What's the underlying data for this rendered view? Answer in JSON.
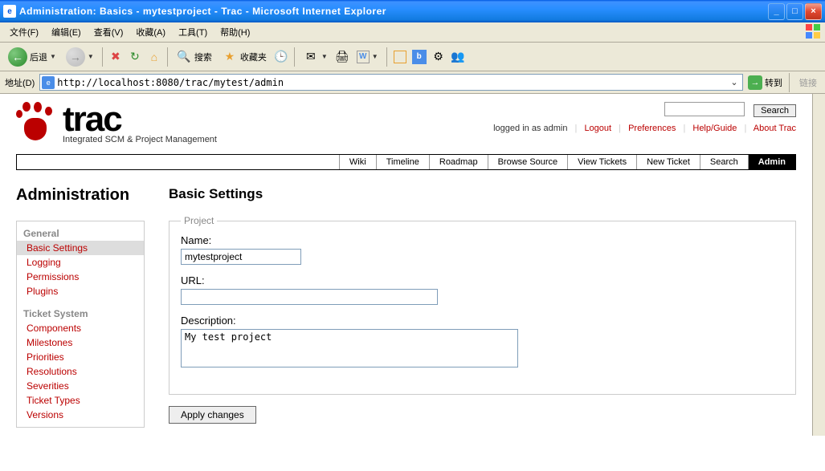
{
  "window": {
    "title": "Administration: Basics - mytestproject - Trac - Microsoft Internet Explorer"
  },
  "menubar": {
    "file": "文件(F)",
    "edit": "编辑(E)",
    "view": "查看(V)",
    "favorites": "收藏(A)",
    "tools": "工具(T)",
    "help": "帮助(H)"
  },
  "toolbar": {
    "back": "后退",
    "search": "搜索",
    "favorites": "收藏夹"
  },
  "addressbar": {
    "label": "地址(D)",
    "url": "http://localhost:8080/trac/mytest/admin",
    "go": "转到",
    "links": "链接"
  },
  "trac": {
    "subtitle": "Integrated SCM & Project Management",
    "search_btn": "Search",
    "logged_in": "logged in as admin",
    "logout": "Logout",
    "prefs": "Preferences",
    "help": "Help/Guide",
    "about": "About Trac"
  },
  "mainnav": {
    "wiki": "Wiki",
    "timeline": "Timeline",
    "roadmap": "Roadmap",
    "browse": "Browse Source",
    "view_tickets": "View Tickets",
    "new_ticket": "New Ticket",
    "search": "Search",
    "admin": "Admin"
  },
  "admin": {
    "heading": "Administration",
    "groups": {
      "general": "General",
      "ticket": "Ticket System"
    },
    "items": {
      "basic": "Basic Settings",
      "logging": "Logging",
      "permissions": "Permissions",
      "plugins": "Plugins",
      "components": "Components",
      "milestones": "Milestones",
      "priorities": "Priorities",
      "resolutions": "Resolutions",
      "severities": "Severities",
      "ticket_types": "Ticket Types",
      "versions": "Versions"
    }
  },
  "panel": {
    "title": "Basic Settings",
    "legend": "Project",
    "name_label": "Name:",
    "name_value": "mytestproject",
    "url_label": "URL:",
    "url_value": "",
    "desc_label": "Description:",
    "desc_value": "My test project",
    "apply": "Apply changes"
  }
}
